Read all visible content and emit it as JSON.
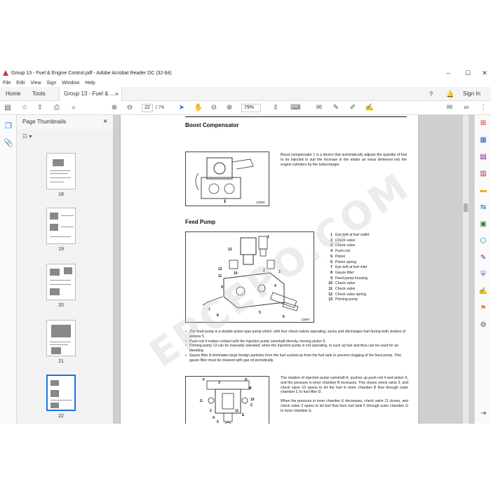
{
  "window": {
    "title": "Group 13 - Fuel & Engine Control.pdf - Adobe Acrobat Reader DC (32-bit)",
    "minimize": "–",
    "maximize": "☐",
    "close": "✕"
  },
  "menu": [
    "File",
    "Edit",
    "View",
    "Sign",
    "Window",
    "Help"
  ],
  "tabs": {
    "home": "Home",
    "tools": "Tools",
    "document": "Group 13 - Fuel & ...",
    "document_close": "×",
    "sign_in": "Sign In"
  },
  "toolbar": {
    "page_current": "22",
    "page_total": "/ 74",
    "zoom": "79%"
  },
  "thumbnails": {
    "title": "Page Thumbnails",
    "close": "×",
    "pages": [
      "18",
      "19",
      "20",
      "21",
      "22"
    ]
  },
  "document": {
    "boost": {
      "heading": "Boost Compensator",
      "text": "Boost compensator 1 is a device that automatically adjusts the quantity of fuel to be injected to suit the increase in the intake air mass delivered into the engine cylinders by the turbocharger.",
      "figure_code": "13093",
      "callout": "1"
    },
    "feed": {
      "heading": "Feed Pump",
      "figure_code": "13097",
      "callouts": [
        "13",
        "1",
        "12",
        "10",
        "11",
        "2",
        "3",
        "9",
        "4",
        "7",
        "8",
        "5",
        "6"
      ],
      "legend": [
        {
          "num": "1",
          "label": "Eye bolt at fuel outlet"
        },
        {
          "num": "2",
          "label": "Check valve"
        },
        {
          "num": "3",
          "label": "Check valve"
        },
        {
          "num": "4",
          "label": "Push rod"
        },
        {
          "num": "5",
          "label": "Piston"
        },
        {
          "num": "6",
          "label": "Piston spring"
        },
        {
          "num": "7",
          "label": "Eye bolt at fuel inlet"
        },
        {
          "num": "8",
          "label": "Gauze filter"
        },
        {
          "num": "9",
          "label": "Feed pump housing"
        },
        {
          "num": "10",
          "label": "Check valve"
        },
        {
          "num": "11",
          "label": "Check valve"
        },
        {
          "num": "12",
          "label": "Check valve spring"
        },
        {
          "num": "13",
          "label": "Priming pump"
        }
      ],
      "bullets": [
        "The feed pump is a double-action type pump which, with four check valves operating, sucks and discharges fuel during both strokes of pistons 5.",
        "Push rod 4 makes contact with the injection pump camshaft directly, moving piston 5.",
        "Priming pump 13 can be manually operated, when the injection pump is not operating, to suck up fuel and thus can be used for air bleeding.",
        "Gauze filter 8 eliminates large foreign particles from the fuel sucked up from the fuel tank to prevent clogging of the feed pump. This gauze filter must be cleaned with gas oil periodically."
      ],
      "operation_figure_code": "13098",
      "operation_callouts": [
        "F",
        "3",
        "D",
        "B",
        "G",
        "10",
        "C",
        "2",
        "11",
        "E",
        "4",
        "5",
        "A"
      ],
      "operation_text_1": "The rotation of injection pump camshaft A, pushes up push rod 4 and piston 5, and the pressure in inner chamber B increases. This closes check valve 3, and check valve 10 opens to let the fuel in inner chamber B flow through outer chamber C to fuel filter D.",
      "operation_text_2": "When the pressure in inner chamber E decreases, check valve 11 closes, and check valve 2 opens to let fuel flow from fuel tank F through outer chamber G to inner chamber E."
    },
    "watermark": "EPCEPO.COM"
  }
}
